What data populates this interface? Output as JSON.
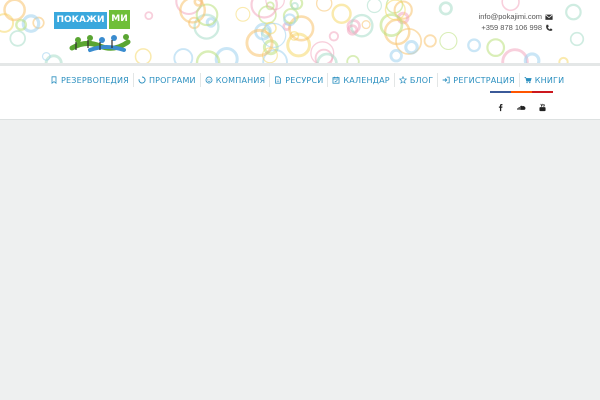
{
  "logo": {
    "word1": "ПОКАЖИ",
    "word2": "МИ"
  },
  "contact": {
    "email": "info@pokajimi.com",
    "phone": "+359 878 106 998",
    "email_icon": "envelope-icon",
    "phone_icon": "phone-icon"
  },
  "nav": {
    "items": [
      {
        "label": "РЕЗЕРВОПЕДИЯ",
        "icon": "bookmark-icon"
      },
      {
        "label": "ПРОГРАМИ",
        "icon": "spinner-icon"
      },
      {
        "label": "КОМПАНИЯ",
        "icon": "smile-icon"
      },
      {
        "label": "РЕСУРСИ",
        "icon": "document-icon"
      },
      {
        "label": "КАЛЕНДАР",
        "icon": "calendar-icon"
      },
      {
        "label": "БЛОГ",
        "icon": "star-icon"
      },
      {
        "label": "РЕГИСТРАЦИЯ",
        "icon": "sign-in-icon"
      },
      {
        "label": "КНИГИ",
        "icon": "cart-icon"
      }
    ]
  },
  "social": {
    "items": [
      {
        "icon": "facebook-icon",
        "color": "#3b5998"
      },
      {
        "icon": "soundcloud-icon",
        "color": "#ff5500"
      },
      {
        "icon": "youtube-icon",
        "color": "#cc181e"
      }
    ]
  },
  "colors": {
    "nav_text": "#2a8fbf",
    "page_bg": "#eef0f0",
    "logo_blue": "#3aa8dd",
    "logo_green": "#6fbf38"
  }
}
